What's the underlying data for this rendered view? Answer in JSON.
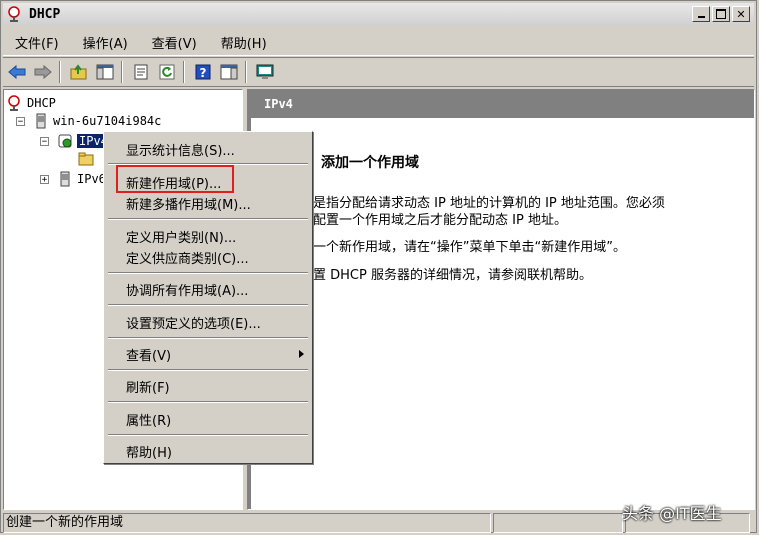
{
  "window": {
    "title": "DHCP"
  },
  "menubar": {
    "items": [
      "文件(F)",
      "操作(A)",
      "查看(V)",
      "帮助(H)"
    ]
  },
  "tree": {
    "root": "DHCP",
    "server": "win-6u7104i984c",
    "ipv4": "IPv4",
    "ipv6": "IPv6"
  },
  "right_pane": {
    "header": "IPv4",
    "heading": "添加一个作用域",
    "para1_line1": "是指分配给请求动态 IP 地址的计算机的 IP 地址范围。您必须",
    "para1_line2": "配置一个作用域之后才能分配动态 IP 地址。",
    "para2": "一个新作用域，请在“操作”菜单下单击“新建作用域”。",
    "para3": "置 DHCP 服务器的详细情况，请参阅联机帮助。"
  },
  "context_menu": {
    "items": [
      "显示统计信息(S)...",
      "新建作用域(P)...",
      "新建多播作用域(M)...",
      "定义用户类别(N)...",
      "定义供应商类别(C)...",
      "协调所有作用域(A)...",
      "设置预定义的选项(E)...",
      "查看(V)",
      "刷新(F)",
      "属性(R)",
      "帮助(H)"
    ]
  },
  "statusbar": {
    "text": "创建一个新的作用域"
  },
  "watermark": "头条 @IT医生"
}
